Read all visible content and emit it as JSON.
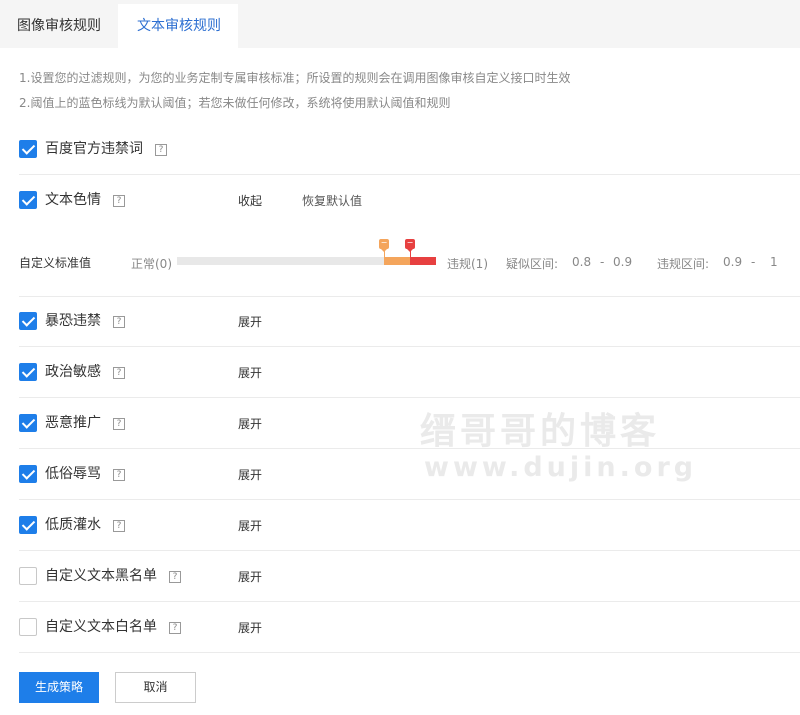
{
  "tabs": [
    {
      "label": "图像审核规则",
      "active": false
    },
    {
      "label": "文本审核规则",
      "active": true
    }
  ],
  "notes": [
    "1.设置您的过滤规则，为您的业务定制专属审核标准；所设置的规则会在调用图像审核自定义接口时生效",
    "2.阈值上的蓝色标线为默认阈值；若您未做任何修改，系统将使用默认阈值和规则"
  ],
  "rules": [
    {
      "label": "百度官方违禁词",
      "checked": true,
      "action": ""
    },
    {
      "label": "文本色情",
      "checked": true,
      "action": "收起",
      "action2": "恢复默认值"
    },
    {
      "label": "暴恐违禁",
      "checked": true,
      "action": "展开"
    },
    {
      "label": "政治敏感",
      "checked": true,
      "action": "展开"
    },
    {
      "label": "恶意推广",
      "checked": true,
      "action": "展开"
    },
    {
      "label": "低俗辱骂",
      "checked": true,
      "action": "展开"
    },
    {
      "label": "低质灌水",
      "checked": true,
      "action": "展开"
    },
    {
      "label": "自定义文本黑名单",
      "checked": false,
      "action": "展开"
    },
    {
      "label": "自定义文本白名单",
      "checked": false,
      "action": "展开"
    }
  ],
  "help_glyph": "?",
  "slider": {
    "title": "自定义标准值",
    "left_label": "正常(0)",
    "right_label": "违规(1)",
    "suspect_label": "疑似区间:",
    "suspect_low": "0.8",
    "suspect_dash": "-",
    "suspect_high": "0.9",
    "violation_label": "违规区间:",
    "violation_low": "0.9",
    "violation_dash": "-",
    "violation_high": "1",
    "suspect_value": 0.8,
    "violation_value": 0.9,
    "handle_glyph": "−",
    "color_suspect": "#f4a55c",
    "color_violation": "#e74040"
  },
  "watermark": {
    "line1": "缙哥哥的博客",
    "line2": "www.dujin.org"
  },
  "buttons": {
    "primary": "生成策略",
    "cancel": "取消"
  },
  "colors": {
    "accent": "#1e7ee9",
    "tab_active_text": "#2d6fd1"
  }
}
